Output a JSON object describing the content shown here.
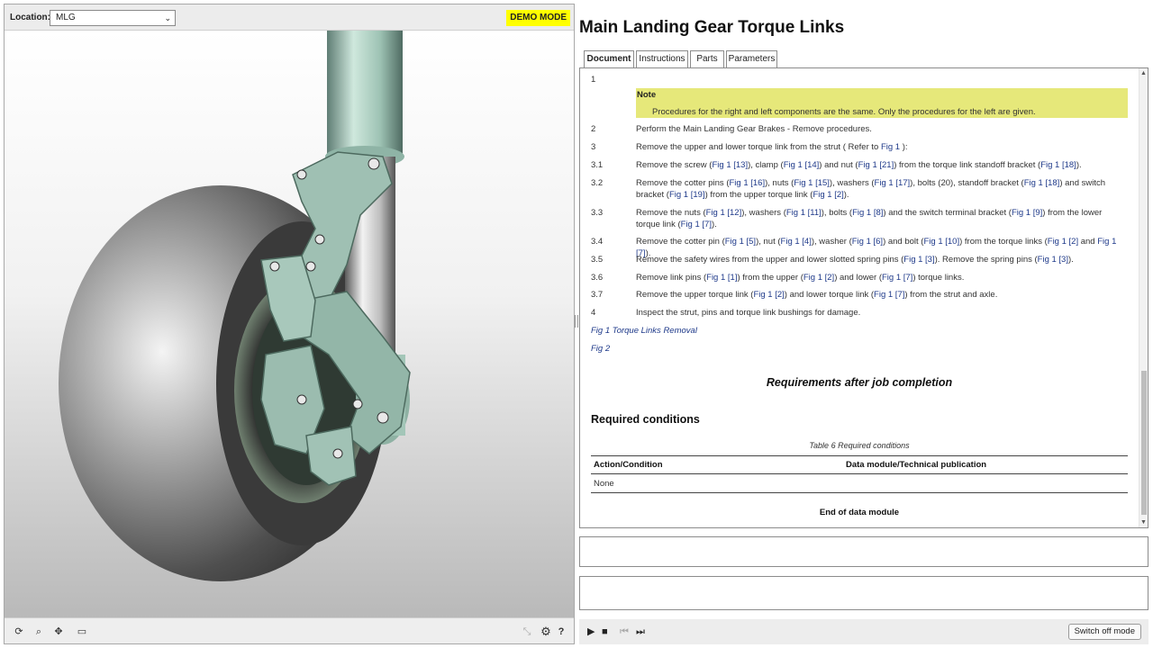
{
  "viewer": {
    "location_label": "Location:",
    "location_value": "MLG",
    "demo_badge": "DEMO MODE",
    "toolbar_icons": [
      "rotate-icon",
      "zoom-icon",
      "pan-icon",
      "fit-icon",
      "hide-icon",
      "settings-icon",
      "help-icon"
    ],
    "settings_glyph": "⚙",
    "help_glyph": "?"
  },
  "document": {
    "title": "Main Landing Gear Torque Links",
    "tabs": [
      {
        "label": "Document",
        "active": true
      },
      {
        "label": "Instructions",
        "active": false
      },
      {
        "label": "Parts",
        "active": false
      },
      {
        "label": "Parameters",
        "active": false
      }
    ],
    "steps": [
      {
        "num": "1",
        "html": ""
      },
      {
        "num": "2",
        "html": "Perform the Main Landing Gear Brakes - Remove procedures."
      },
      {
        "num": "3",
        "html": "Remove the upper and lower torque link from the strut ( Refer to <span class='link'>Fig 1</span> ):"
      },
      {
        "num": "3.1",
        "html": "Remove the screw (<span class='link'>Fig 1 [13]</span>), clamp (<span class='link'>Fig 1 [14]</span>) and nut (<span class='link'>Fig 1 [21]</span>) from the torque link standoff bracket (<span class='link'>Fig 1 [18]</span>)."
      },
      {
        "num": "3.2",
        "html": "Remove the cotter pins (<span class='link'>Fig 1 [16]</span>), nuts (<span class='link'>Fig 1 [15]</span>), washers (<span class='link'>Fig 1 [17]</span>), bolts (20), standoff bracket (<span class='link'>Fig 1 [18]</span>) and switch bracket (<span class='link'>Fig 1 [19]</span>) from the upper torque link (<span class='link'>Fig 1 [2]</span>)."
      },
      {
        "num": "3.3",
        "html": "Remove the nuts (<span class='link'>Fig 1 [12]</span>), washers (<span class='link'>Fig 1 [11]</span>), bolts (<span class='link'>Fig 1 [8]</span>) and the switch terminal bracket (<span class='link'>Fig 1 [9]</span>) from the lower torque link (<span class='link'>Fig 1 [7]</span>)."
      },
      {
        "num": "3.4",
        "html": "Remove the cotter pin (<span class='link'>Fig 1 [5]</span>), nut (<span class='link'>Fig 1 [4]</span>), washer (<span class='link'>Fig 1 [6]</span>) and bolt (<span class='link'>Fig 1 [10]</span>) from the torque links (<span class='link'>Fig 1 [2]</span> and <span class='link'>Fig 1 [7]</span>)."
      },
      {
        "num": "3.5",
        "html": "Remove the safety wires from the upper and lower slotted spring pins (<span class='link'>Fig 1 [3]</span>). Remove the spring pins (<span class='link'>Fig 1 [3]</span>)."
      },
      {
        "num": "3.6",
        "html": "Remove link pins (<span class='link'>Fig 1 [1]</span>) from the upper (<span class='link'>Fig 1 [2]</span>) and lower (<span class='link'>Fig 1 [7]</span>) torque links."
      },
      {
        "num": "3.7",
        "html": "Remove the upper torque link (<span class='link'>Fig 1 [2]</span>) and lower torque link (<span class='link'>Fig 1 [7]</span>) from the strut and axle."
      },
      {
        "num": "4",
        "html": "Inspect the strut, pins and torque link bushings for damage."
      }
    ],
    "note": {
      "title": "Note",
      "text": "Procedures for the right and left components are the same. Only the procedures for the left are given."
    },
    "fig1_caption": "Fig 1 Torque Links Removal",
    "fig2_caption": "Fig 2",
    "requirements_heading": "Requirements after job completion",
    "required_conditions_heading": "Required conditions",
    "table_caption": "Table 6 Required conditions",
    "table_headers": [
      "Action/Condition",
      "Data module/Technical publication"
    ],
    "table_rows": [
      [
        "None",
        ""
      ]
    ],
    "end_text": "End of data module"
  },
  "player": {
    "switch_label": "Switch off mode"
  }
}
